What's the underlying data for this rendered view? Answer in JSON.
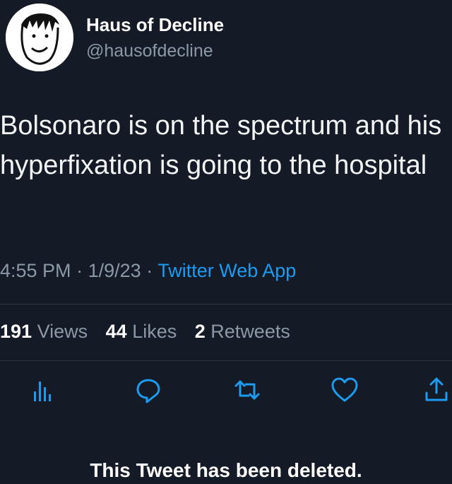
{
  "author": {
    "display_name": "Haus of Decline",
    "handle": "@hausofdecline"
  },
  "tweet": {
    "text": "Bolsonaro is on the spectrum and his hyperfixation is going to the hospital",
    "time": "4:55 PM",
    "separator": "·",
    "date": "1/9/23",
    "source": "Twitter Web App"
  },
  "stats": {
    "views_count": "191",
    "views_label": "Views",
    "likes_count": "44",
    "likes_label": "Likes",
    "retweets_count": "2",
    "retweets_label": "Retweets"
  },
  "actions": {
    "icons": [
      "analytics-icon",
      "reply-icon",
      "retweet-icon",
      "like-icon",
      "share-icon"
    ]
  },
  "overlay": {
    "caption": "This Tweet has been deleted."
  },
  "colors": {
    "background": "#151b26",
    "accent": "#1d9bf0",
    "secondary_text": "#8b98a5",
    "icon": "#1d9bf0"
  }
}
